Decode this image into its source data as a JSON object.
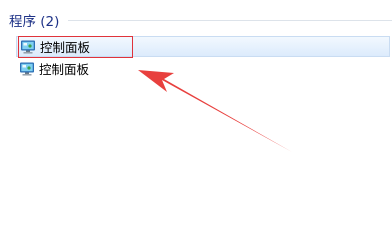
{
  "section": {
    "title": "程序 (2)"
  },
  "results": [
    {
      "label": "控制面板",
      "icon": "control-panel-icon",
      "selected": true
    },
    {
      "label": "控制面板",
      "icon": "control-panel-icon",
      "selected": false
    }
  ],
  "colors": {
    "header_text": "#1e3287",
    "selection_border": "#c9dcf2",
    "highlight_box": "#e0333b",
    "annotation_arrow": "#e8403e"
  }
}
